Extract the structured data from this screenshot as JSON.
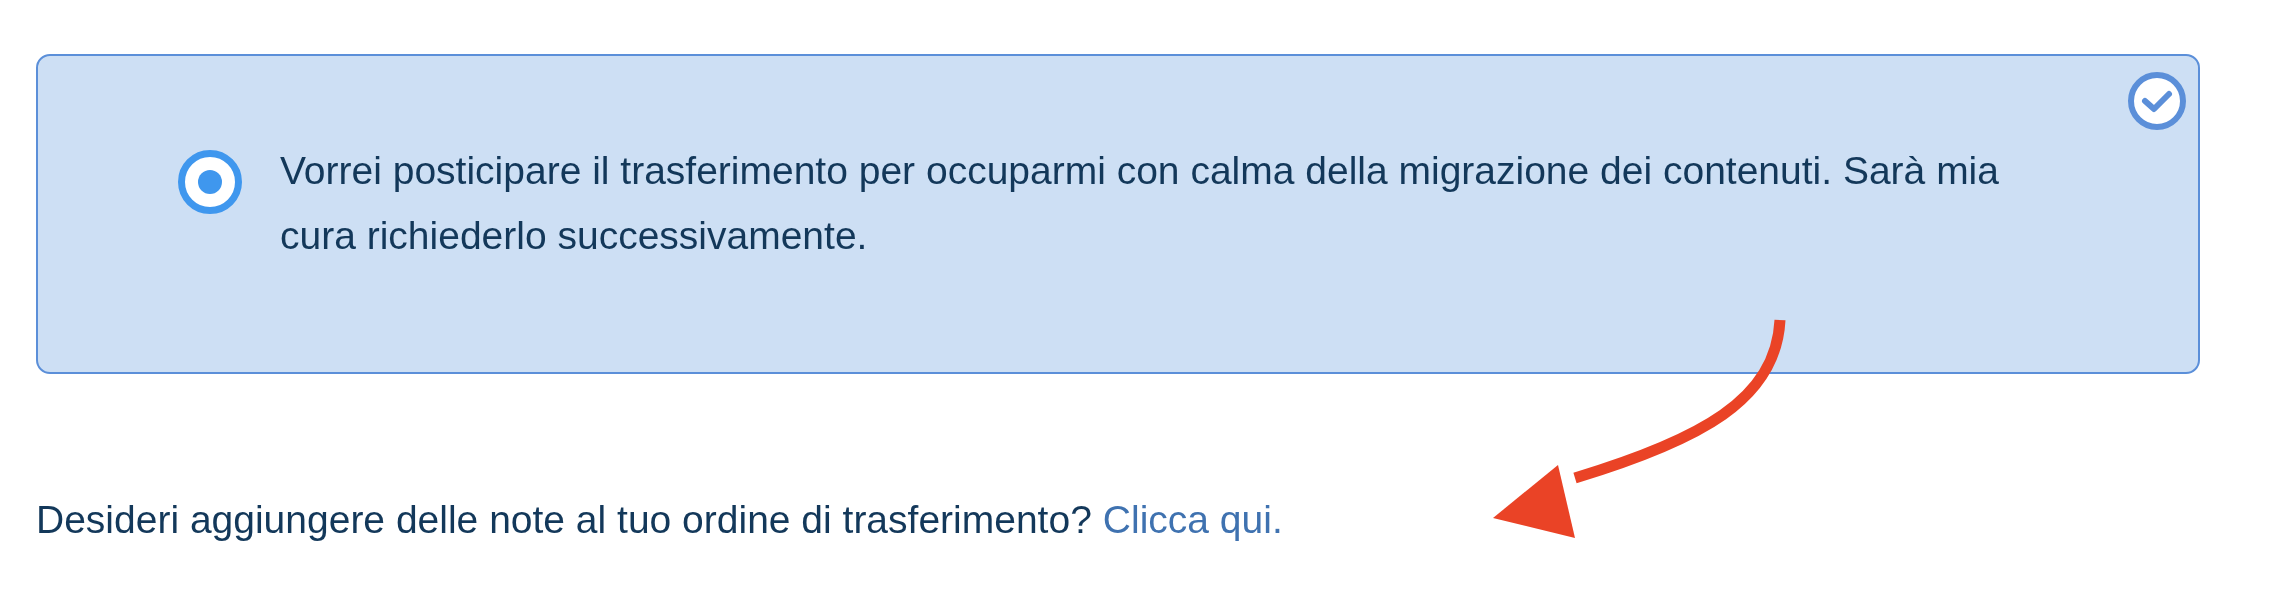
{
  "option": {
    "text": "Vorrei posticipare il trasferimento per occuparmi con calma della migrazione dei contenuti. Sarà mia cura richiederlo successivamente.",
    "selected": true
  },
  "note": {
    "text": "Desideri aggiungere delle note al tuo ordine di trasferimento?",
    "link": "Clicca qui."
  }
}
